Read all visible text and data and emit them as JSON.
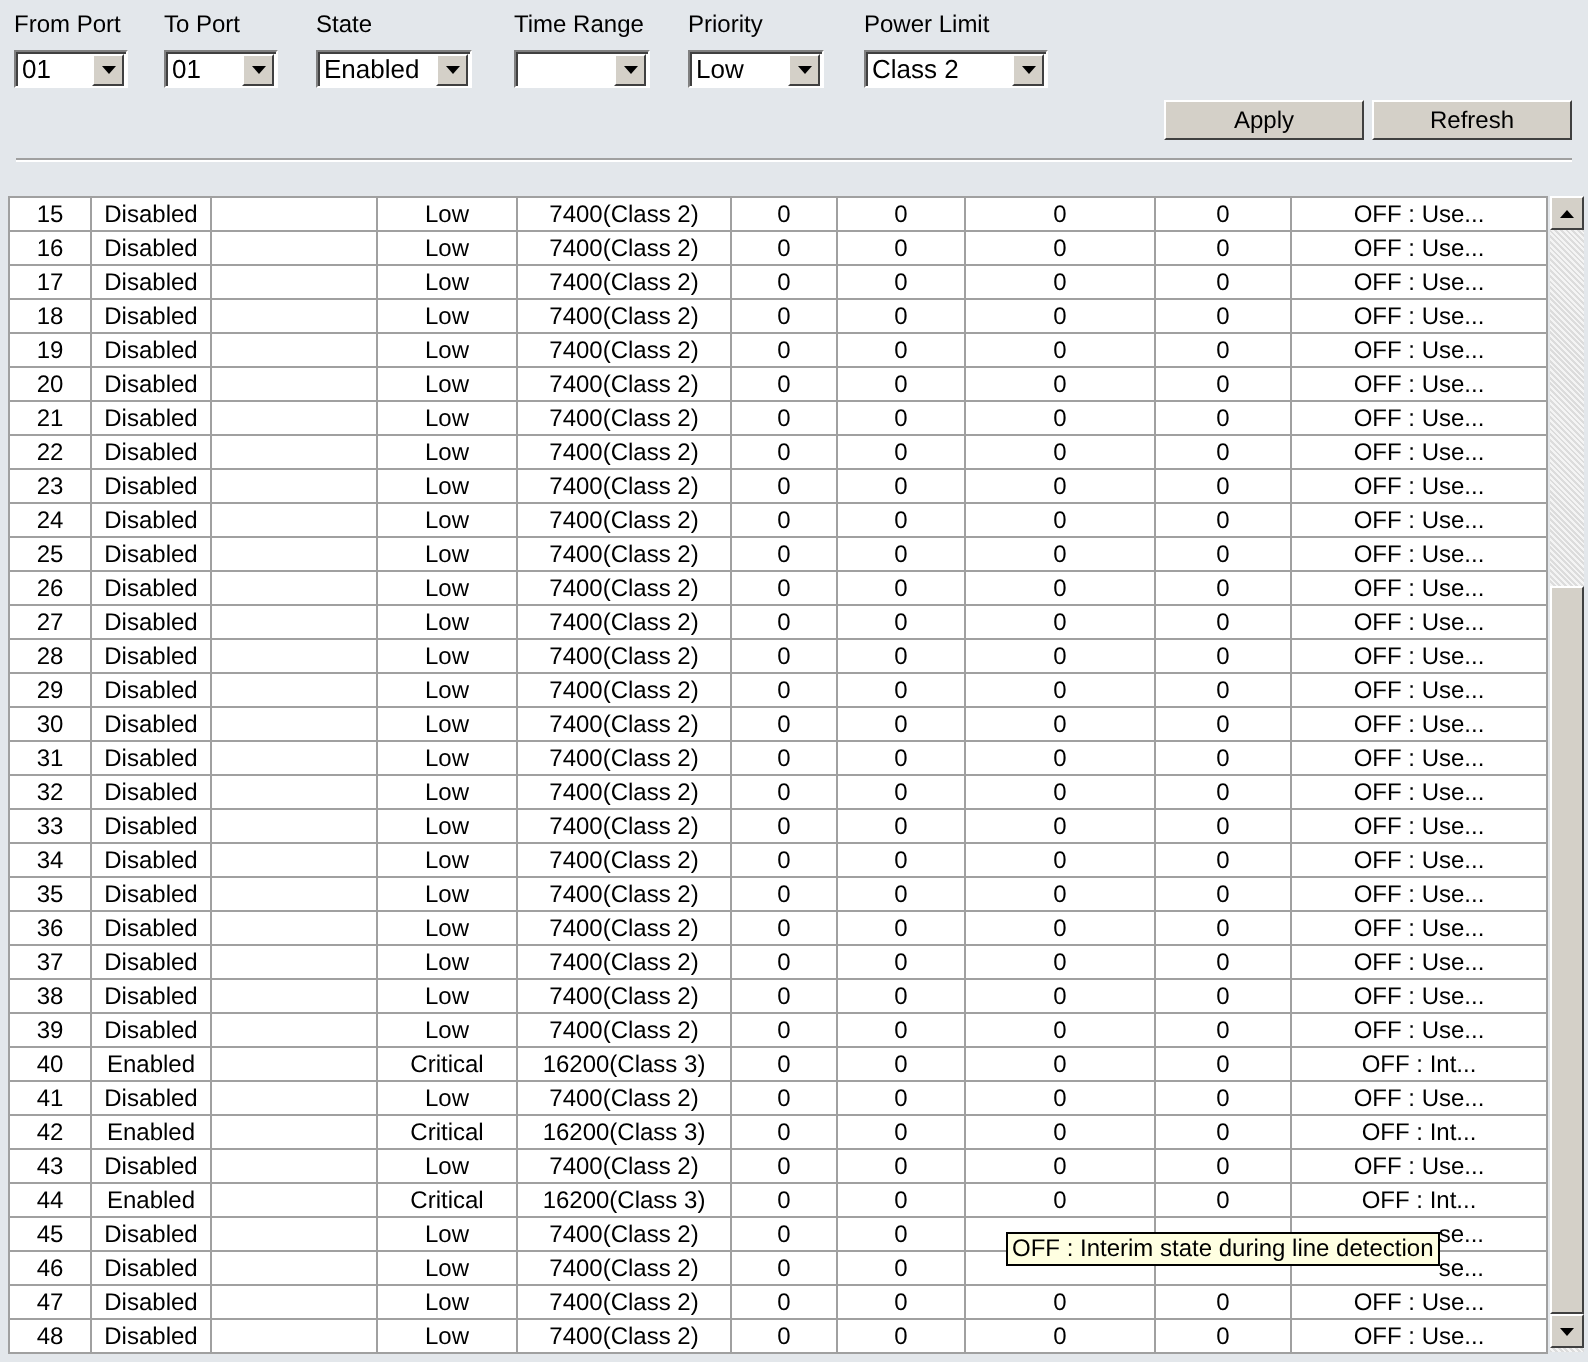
{
  "filters": [
    {
      "label": "From Port",
      "value": "01"
    },
    {
      "label": "To Port",
      "value": "01"
    },
    {
      "label": "State",
      "value": "Enabled"
    },
    {
      "label": "Time Range"
    },
    {
      "label": "Priority",
      "value": "Low"
    },
    {
      "label": "Power Limit",
      "value": "Class 2"
    }
  ],
  "buttons": [
    "Apply",
    "Refresh"
  ],
  "table": {
    "rows": [
      {
        "port": "15",
        "state": "Disabled",
        "priority": "Low",
        "power_limit": "7400(Class 2)",
        "column_6": "0",
        "column_7": "0",
        "column_8": "0",
        "column_9": "0",
        "status": "OFF : Use..."
      },
      {
        "port": "16",
        "state": "Disabled",
        "priority": "Low",
        "power_limit": "7400(Class 2)",
        "column_6": "0",
        "column_7": "0",
        "column_8": "0",
        "column_9": "0",
        "status": "OFF : Use..."
      },
      {
        "port": "17",
        "state": "Disabled",
        "priority": "Low",
        "power_limit": "7400(Class 2)",
        "column_6": "0",
        "column_7": "0",
        "column_8": "0",
        "column_9": "0",
        "status": "OFF : Use..."
      },
      {
        "port": "18",
        "state": "Disabled",
        "priority": "Low",
        "power_limit": "7400(Class 2)",
        "column_6": "0",
        "column_7": "0",
        "column_8": "0",
        "column_9": "0",
        "status": "OFF : Use..."
      },
      {
        "port": "19",
        "state": "Disabled",
        "priority": "Low",
        "power_limit": "7400(Class 2)",
        "column_6": "0",
        "column_7": "0",
        "column_8": "0",
        "column_9": "0",
        "status": "OFF : Use..."
      },
      {
        "port": "20",
        "state": "Disabled",
        "priority": "Low",
        "power_limit": "7400(Class 2)",
        "column_6": "0",
        "column_7": "0",
        "column_8": "0",
        "column_9": "0",
        "status": "OFF : Use..."
      },
      {
        "port": "21",
        "state": "Disabled",
        "priority": "Low",
        "power_limit": "7400(Class 2)",
        "column_6": "0",
        "column_7": "0",
        "column_8": "0",
        "column_9": "0",
        "status": "OFF : Use..."
      },
      {
        "port": "22",
        "state": "Disabled",
        "priority": "Low",
        "power_limit": "7400(Class 2)",
        "column_6": "0",
        "column_7": "0",
        "column_8": "0",
        "column_9": "0",
        "status": "OFF : Use..."
      },
      {
        "port": "23",
        "state": "Disabled",
        "priority": "Low",
        "power_limit": "7400(Class 2)",
        "column_6": "0",
        "column_7": "0",
        "column_8": "0",
        "column_9": "0",
        "status": "OFF : Use..."
      },
      {
        "port": "24",
        "state": "Disabled",
        "priority": "Low",
        "power_limit": "7400(Class 2)",
        "column_6": "0",
        "column_7": "0",
        "column_8": "0",
        "column_9": "0",
        "status": "OFF : Use..."
      },
      {
        "port": "25",
        "state": "Disabled",
        "priority": "Low",
        "power_limit": "7400(Class 2)",
        "column_6": "0",
        "column_7": "0",
        "column_8": "0",
        "column_9": "0",
        "status": "OFF : Use..."
      },
      {
        "port": "26",
        "state": "Disabled",
        "priority": "Low",
        "power_limit": "7400(Class 2)",
        "column_6": "0",
        "column_7": "0",
        "column_8": "0",
        "column_9": "0",
        "status": "OFF : Use..."
      },
      {
        "port": "27",
        "state": "Disabled",
        "priority": "Low",
        "power_limit": "7400(Class 2)",
        "column_6": "0",
        "column_7": "0",
        "column_8": "0",
        "column_9": "0",
        "status": "OFF : Use..."
      },
      {
        "port": "28",
        "state": "Disabled",
        "priority": "Low",
        "power_limit": "7400(Class 2)",
        "column_6": "0",
        "column_7": "0",
        "column_8": "0",
        "column_9": "0",
        "status": "OFF : Use..."
      },
      {
        "port": "29",
        "state": "Disabled",
        "priority": "Low",
        "power_limit": "7400(Class 2)",
        "column_6": "0",
        "column_7": "0",
        "column_8": "0",
        "column_9": "0",
        "status": "OFF : Use..."
      },
      {
        "port": "30",
        "state": "Disabled",
        "priority": "Low",
        "power_limit": "7400(Class 2)",
        "column_6": "0",
        "column_7": "0",
        "column_8": "0",
        "column_9": "0",
        "status": "OFF : Use..."
      },
      {
        "port": "31",
        "state": "Disabled",
        "priority": "Low",
        "power_limit": "7400(Class 2)",
        "column_6": "0",
        "column_7": "0",
        "column_8": "0",
        "column_9": "0",
        "status": "OFF : Use..."
      },
      {
        "port": "32",
        "state": "Disabled",
        "priority": "Low",
        "power_limit": "7400(Class 2)",
        "column_6": "0",
        "column_7": "0",
        "column_8": "0",
        "column_9": "0",
        "status": "OFF : Use..."
      },
      {
        "port": "33",
        "state": "Disabled",
        "priority": "Low",
        "power_limit": "7400(Class 2)",
        "column_6": "0",
        "column_7": "0",
        "column_8": "0",
        "column_9": "0",
        "status": "OFF : Use..."
      },
      {
        "port": "34",
        "state": "Disabled",
        "priority": "Low",
        "power_limit": "7400(Class 2)",
        "column_6": "0",
        "column_7": "0",
        "column_8": "0",
        "column_9": "0",
        "status": "OFF : Use..."
      },
      {
        "port": "35",
        "state": "Disabled",
        "priority": "Low",
        "power_limit": "7400(Class 2)",
        "column_6": "0",
        "column_7": "0",
        "column_8": "0",
        "column_9": "0",
        "status": "OFF : Use..."
      },
      {
        "port": "36",
        "state": "Disabled",
        "priority": "Low",
        "power_limit": "7400(Class 2)",
        "column_6": "0",
        "column_7": "0",
        "column_8": "0",
        "column_9": "0",
        "status": "OFF : Use..."
      },
      {
        "port": "37",
        "state": "Disabled",
        "priority": "Low",
        "power_limit": "7400(Class 2)",
        "column_6": "0",
        "column_7": "0",
        "column_8": "0",
        "column_9": "0",
        "status": "OFF : Use..."
      },
      {
        "port": "38",
        "state": "Disabled",
        "priority": "Low",
        "power_limit": "7400(Class 2)",
        "column_6": "0",
        "column_7": "0",
        "column_8": "0",
        "column_9": "0",
        "status": "OFF : Use..."
      },
      {
        "port": "39",
        "state": "Disabled",
        "priority": "Low",
        "power_limit": "7400(Class 2)",
        "column_6": "0",
        "column_7": "0",
        "column_8": "0",
        "column_9": "0",
        "status": "OFF : Use..."
      },
      {
        "port": "40",
        "state": "Enabled",
        "priority": "Critical",
        "power_limit": "16200(Class 3)",
        "column_6": "0",
        "column_7": "0",
        "column_8": "0",
        "column_9": "0",
        "status": "OFF : Int..."
      },
      {
        "port": "41",
        "state": "Disabled",
        "priority": "Low",
        "power_limit": "7400(Class 2)",
        "column_6": "0",
        "column_7": "0",
        "column_8": "0",
        "column_9": "0",
        "status": "OFF : Use..."
      },
      {
        "port": "42",
        "state": "Enabled",
        "priority": "Critical",
        "power_limit": "16200(Class 3)",
        "column_6": "0",
        "column_7": "0",
        "column_8": "0",
        "column_9": "0",
        "status": "OFF : Int..."
      },
      {
        "port": "43",
        "state": "Disabled",
        "priority": "Low",
        "power_limit": "7400(Class 2)",
        "column_6": "0",
        "column_7": "0",
        "column_8": "0",
        "column_9": "0",
        "status": "OFF : Use..."
      },
      {
        "port": "44",
        "state": "Enabled",
        "priority": "Critical",
        "power_limit": "16200(Class 3)",
        "column_6": "0",
        "column_7": "0",
        "column_8": "0",
        "column_9": "0",
        "status": "OFF : Int..."
      },
      {
        "port": "45",
        "state": "Disabled",
        "priority": "Low",
        "power_limit": "7400(Class 2)",
        "column_6": "0",
        "column_7": "0",
        "status": "se...",
        "under_tooltip": true
      },
      {
        "port": "46",
        "state": "Disabled",
        "priority": "Low",
        "power_limit": "7400(Class 2)",
        "column_6": "0",
        "column_7": "0",
        "status": "se...",
        "under_tooltip": true
      },
      {
        "port": "47",
        "state": "Disabled",
        "priority": "Low",
        "power_limit": "7400(Class 2)",
        "column_6": "0",
        "column_7": "0",
        "column_8": "0",
        "column_9": "0",
        "status": "OFF : Use..."
      },
      {
        "port": "48",
        "state": "Disabled",
        "priority": "Low",
        "power_limit": "7400(Class 2)",
        "column_6": "0",
        "column_7": "0",
        "column_8": "0",
        "column_9": "0",
        "status": "OFF : Use..."
      }
    ]
  },
  "tooltip": "OFF : Interim state during line detection"
}
